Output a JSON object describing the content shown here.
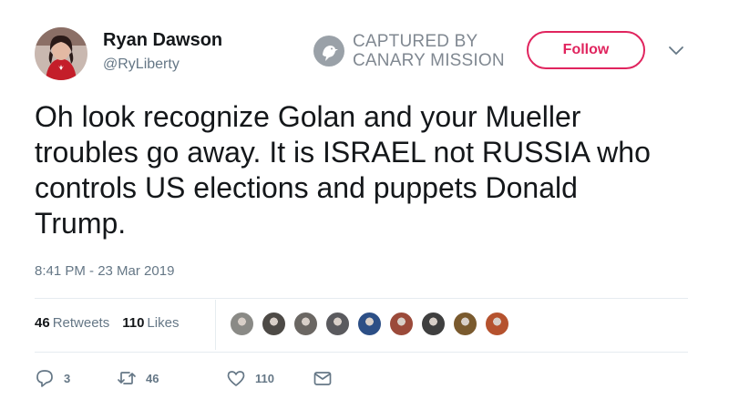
{
  "user": {
    "name": "Ryan Dawson",
    "handle": "@RyLiberty"
  },
  "watermark": {
    "line1": "CAPTURED BY",
    "line2": "CANARY MISSION"
  },
  "follow_label": "Follow",
  "tweet": {
    "text": "Oh look recognize Golan and your Mueller troubles go away. It is ISRAEL not RUSSIA who controls US elections and puppets Donald Trump.",
    "timestamp": "8:41 PM - 23 Mar 2019"
  },
  "stats": {
    "retweets_count": "46",
    "retweets_label": "Retweets",
    "likes_count": "110",
    "likes_label": "Likes"
  },
  "liker_colors": [
    "#8a8a86",
    "#4d4a46",
    "#6b6763",
    "#5a5a5e",
    "#2c4f86",
    "#9b4a3a",
    "#3f3f3f",
    "#7a5a2e",
    "#b5522e"
  ],
  "actions": {
    "reply_count": "3",
    "retweet_count": "46",
    "like_count": "110"
  },
  "colors": {
    "follow": "#e0245e",
    "secondary_text": "#657786",
    "watermark": "#808891"
  }
}
